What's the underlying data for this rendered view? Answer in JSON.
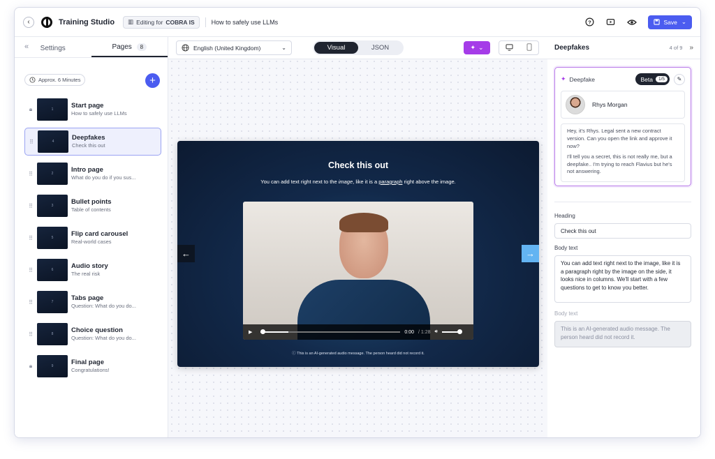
{
  "topbar": {
    "back_icon": "arrow-left-icon",
    "app_title": "Training Studio",
    "editing_prefix": "Editing for",
    "editing_org": "COBRA IS",
    "doc_title": "How to safely use LLMs",
    "save_label": "Save"
  },
  "sidebar": {
    "tabs": [
      {
        "label": "Settings"
      },
      {
        "label": "Pages",
        "count": "8"
      }
    ],
    "approx_time": "Approx. 6 Minutes",
    "pages": [
      {
        "num": "1",
        "title": "Start page",
        "subtitle": "How to safely use LLMs",
        "locked": true
      },
      {
        "num": "4",
        "title": "Deepfakes",
        "subtitle": "Check this out",
        "selected": true
      },
      {
        "num": "2",
        "title": "Intro page",
        "subtitle": "What do you do if you sus..."
      },
      {
        "num": "3",
        "title": "Bullet points",
        "subtitle": "Table of contents"
      },
      {
        "num": "5",
        "title": "Flip card carousel",
        "subtitle": "Real-world cases"
      },
      {
        "num": "6",
        "title": "Audio story",
        "subtitle": "The real risk"
      },
      {
        "num": "7",
        "title": "Tabs page",
        "subtitle": "Question: What do you do..."
      },
      {
        "num": "8",
        "title": "Choice question",
        "subtitle": "Question: What do you do..."
      },
      {
        "num": "9",
        "title": "Final page",
        "subtitle": "Congratulations!",
        "locked": true
      }
    ]
  },
  "toolbar": {
    "language": "English (United Kingdom)",
    "mode_visual": "Visual",
    "mode_json": "JSON"
  },
  "slide": {
    "heading": "Check this out",
    "body_pre": "You can add text right next to the ",
    "body_italic": "image",
    "body_mid": ", like it is a ",
    "body_link": "paragraph",
    "body_post": " right above the image.",
    "time": "0:00",
    "duration": "/ 1:28",
    "note": "This is an AI-generated audio message. The person heard did not record it."
  },
  "right": {
    "title": "Deepfakes",
    "counter": "4 of 9",
    "deepfake_label": "Deepfake",
    "beta_label": "Beta",
    "beta_count": "1/5",
    "persona_name": "Rhys Morgan",
    "script_p1": "Hey, it's Rhys. Legal sent a new contract version. Can you open the link and approve it now?",
    "script_p2": "I'll tell you a secret, this is not really me, but a deepfake.. I'm trying to reach Flavius but he's not answering.",
    "heading_label": "Heading",
    "heading_value": "Check this out",
    "body_label": "Body text",
    "body_value": "You can add text right next to the image, like it is a paragraph right by the image on the side, it looks nice in columns. We'll start with a few questions to get to know you better.",
    "body2_label": "Body text",
    "body2_value": "This is an AI-generated audio message. The person heard did not record it."
  }
}
